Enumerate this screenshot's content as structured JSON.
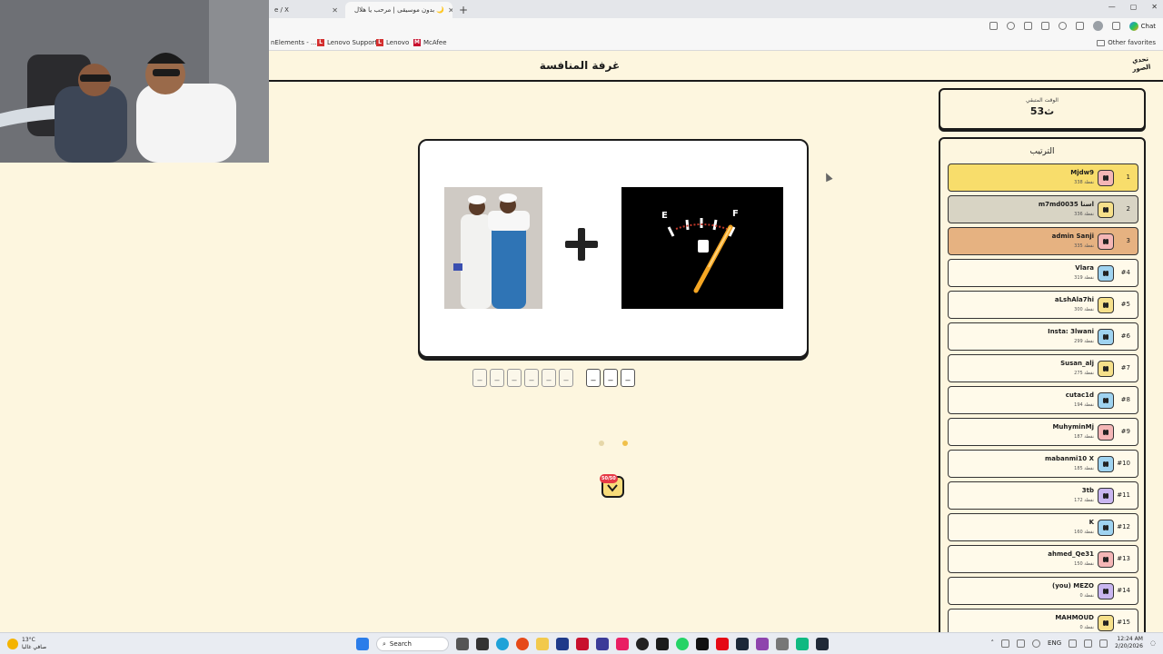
{
  "browser": {
    "tabs": [
      {
        "label": "e / X",
        "close": "✕"
      },
      {
        "label": "بدون موسيقى | مرحب يا هلال 🌙",
        "close": "✕"
      }
    ],
    "new_tab": "+",
    "bookmarks": [
      {
        "label": "nElements - ..."
      },
      {
        "label": "Lenovo Support",
        "icon_text": "L"
      },
      {
        "label": "Lenovo",
        "icon_text": "L"
      },
      {
        "label": "McAfee",
        "icon_text": "M"
      }
    ],
    "other_favorites": "Other favorites",
    "chat_label": "Chat",
    "window_controls": [
      "—",
      "▢",
      "✕"
    ]
  },
  "header": {
    "room_title": "غرفة المنافسة",
    "logo_text": "تحدي الصور"
  },
  "puzzle": {
    "plus_symbol": "+",
    "gauge_labels": {
      "empty": "E",
      "full": "F"
    },
    "answer_slots": [
      {
        "char": "_"
      },
      {
        "char": "_"
      },
      {
        "char": "_"
      },
      {
        "char": "_"
      },
      {
        "char": "_"
      },
      {
        "char": "_"
      }
    ],
    "answer_slots_2": [
      {
        "char": "_"
      },
      {
        "char": "_"
      },
      {
        "char": "_"
      }
    ],
    "hint_badge": "50/50"
  },
  "timer": {
    "label": "الوقت المتبقي",
    "value": "53ث"
  },
  "ranking": {
    "title": "الترتيب",
    "colors": {
      "first": "#f8dd6b",
      "second": "#d8d4c4",
      "third": "#e6b281"
    },
    "rows": [
      {
        "rank": "1",
        "name": "Mjdw9",
        "score": "338 نقطة",
        "face_color": "#f4b6b6"
      },
      {
        "rank": "2",
        "name": "m7md0035 اسنا",
        "score": "336 نقطة",
        "face_color": "#f6e08a"
      },
      {
        "rank": "3",
        "name": "admin Sanji",
        "score": "335 نقطة",
        "face_color": "#f4b6b6"
      },
      {
        "rank": "#4",
        "name": "Vlara",
        "score": "319 نقطة",
        "face_color": "#9fd3f0"
      },
      {
        "rank": "#5",
        "name": "aLshAla7hi",
        "score": "300 نقطة",
        "face_color": "#f6e08a"
      },
      {
        "rank": "#6",
        "name": "Insta: 3lwani",
        "score": "299 نقطة",
        "face_color": "#9fd3f0"
      },
      {
        "rank": "#7",
        "name": "Susan_alj",
        "score": "275 نقطة",
        "face_color": "#f6e08a"
      },
      {
        "rank": "#8",
        "name": "cutac1d",
        "score": "194 نقطة",
        "face_color": "#9fd3f0"
      },
      {
        "rank": "#9",
        "name": "MuhyminMj",
        "score": "187 نقطة",
        "face_color": "#f4b6b6"
      },
      {
        "rank": "#10",
        "name": "mabanmi10 X",
        "score": "185 نقطة",
        "face_color": "#9fd3f0"
      },
      {
        "rank": "#11",
        "name": "3tb",
        "score": "172 نقطة",
        "face_color": "#c9b6f0"
      },
      {
        "rank": "#12",
        "name": "K",
        "score": "160 نقطة",
        "face_color": "#9fd3f0"
      },
      {
        "rank": "#13",
        "name": "ahmed_Qe31",
        "score": "150 نقطة",
        "face_color": "#f4b6b6"
      },
      {
        "rank": "#14",
        "name": "(you) MEZO",
        "score": "0 نقطة",
        "face_color": "#c9b6f0"
      },
      {
        "rank": "#15",
        "name": "MAHMOUD",
        "score": "0 نقطة",
        "face_color": "#f6e08a"
      }
    ]
  },
  "taskbar": {
    "weather_temp": "13°C",
    "weather_desc": "صافي غالبا",
    "search_placeholder": "Search",
    "lang": "ENG",
    "time": "12:24 AM",
    "date": "2/20/2026"
  }
}
